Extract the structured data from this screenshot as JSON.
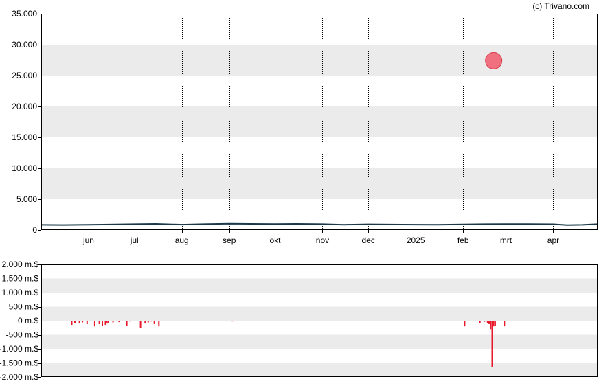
{
  "credit": "(c) Trivano.com",
  "colors": {
    "band": "#ebebeb",
    "price_line": "#1a3a4a",
    "volume_bar": "#e8192c",
    "marker_fill": "#f0707f",
    "marker_stroke": "#d63a4b"
  },
  "chart_data": [
    {
      "type": "line",
      "y_tick_labels": [
        "0",
        "5.000",
        "10.000",
        "15.000",
        "20.000",
        "25.000",
        "30.000",
        "35.000"
      ],
      "y_ticks": [
        0,
        5000,
        10000,
        15000,
        20000,
        25000,
        30000,
        35000
      ],
      "ylim": [
        0,
        35000
      ],
      "x_tick_labels": [
        "jun",
        "jul",
        "aug",
        "sep",
        "okt",
        "nov",
        "dec",
        "2025",
        "feb",
        "mrt",
        "apr"
      ],
      "x_ticks": [
        "2024-06-01",
        "2024-07-01",
        "2024-08-01",
        "2024-09-01",
        "2024-10-01",
        "2024-11-01",
        "2024-12-01",
        "2025-01-01",
        "2025-02-01",
        "2025-03-01",
        "2025-04-01"
      ],
      "xlim": [
        "2024-05-01",
        "2025-04-30"
      ],
      "grid": true,
      "series": [
        {
          "x": [
            "2024-05-01",
            "2024-05-15",
            "2024-06-01",
            "2024-06-15",
            "2024-07-01",
            "2024-07-15",
            "2024-08-01",
            "2024-08-15",
            "2024-09-01",
            "2024-09-15",
            "2024-10-01",
            "2024-10-15",
            "2024-11-01",
            "2024-11-15",
            "2024-12-01",
            "2024-12-15",
            "2025-01-01",
            "2025-01-15",
            "2025-02-01",
            "2025-02-15",
            "2025-03-01",
            "2025-03-15",
            "2025-04-01",
            "2025-04-10",
            "2025-04-20",
            "2025-04-30"
          ],
          "y": [
            850,
            820,
            860,
            900,
            950,
            1000,
            880,
            950,
            1020,
            1000,
            980,
            1000,
            950,
            870,
            930,
            900,
            880,
            860,
            920,
            950,
            980,
            970,
            940,
            800,
            850,
            950
          ]
        }
      ],
      "markers": [
        {
          "x": "2025-02-21",
          "y": 27400
        }
      ]
    },
    {
      "type": "bar",
      "y_tick_labels": [
        "-2.000 m.$",
        "-1.500 m.$",
        "-1.000 m.$",
        "-500 m.$",
        "0 m.$",
        "500 m.$",
        "1.000 m.$",
        "1.500 m.$",
        "2.000 m.$"
      ],
      "y_ticks": [
        -2000,
        -1500,
        -1000,
        -500,
        0,
        500,
        1000,
        1500,
        2000
      ],
      "ylim": [
        -2000,
        2000
      ],
      "xlim": [
        "2024-05-01",
        "2025-04-30"
      ],
      "grid": true,
      "series": [
        {
          "x": [
            "2024-05-21",
            "2024-05-23",
            "2024-05-26",
            "2024-05-28",
            "2024-05-31",
            "2024-06-05",
            "2024-06-08",
            "2024-06-10",
            "2024-06-12",
            "2024-06-13",
            "2024-06-14",
            "2024-06-17",
            "2024-06-21",
            "2024-06-26",
            "2024-06-28",
            "2024-07-05",
            "2024-07-08",
            "2024-07-10",
            "2024-07-12",
            "2024-07-14",
            "2024-07-17",
            "2024-08-29",
            "2024-09-03",
            "2025-02-02",
            "2025-02-12",
            "2025-02-15",
            "2025-02-17",
            "2025-02-18",
            "2025-02-19",
            "2025-02-20",
            "2025-02-21",
            "2025-02-22",
            "2025-02-28"
          ],
          "y": [
            -150,
            -80,
            -100,
            -60,
            -120,
            -200,
            -120,
            -180,
            -150,
            -100,
            -80,
            -60,
            -50,
            -180,
            -30,
            -250,
            -100,
            -60,
            -30,
            -120,
            -200,
            -20,
            -30,
            -200,
            -80,
            -40,
            -80,
            -120,
            -300,
            -1650,
            -200,
            -180,
            -200
          ]
        }
      ]
    }
  ]
}
